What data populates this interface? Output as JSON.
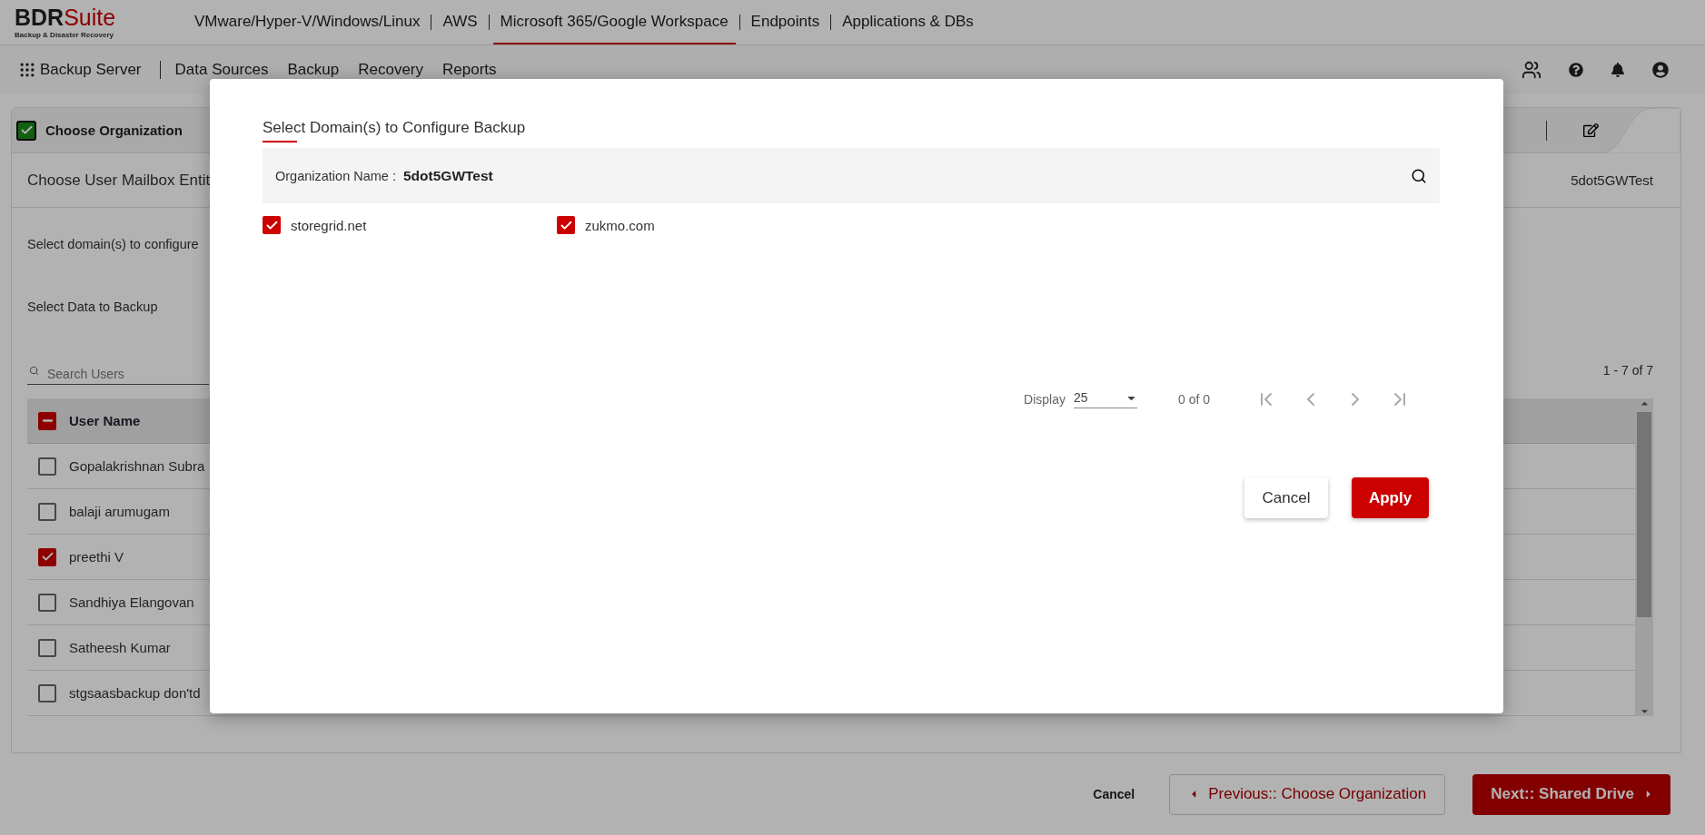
{
  "brand": {
    "name_dark": "BDR",
    "name_red": "Suite",
    "tagline": "Backup & Disaster Recovery"
  },
  "top_tabs": [
    {
      "label": "VMware/Hyper-V/Windows/Linux",
      "selected": false
    },
    {
      "label": "AWS",
      "selected": false
    },
    {
      "label": "Microsoft 365/Google Workspace",
      "selected": true
    },
    {
      "label": "Endpoints",
      "selected": false
    },
    {
      "label": "Applications & DBs",
      "selected": false
    }
  ],
  "nav": {
    "server": "Backup Server",
    "items": [
      "Data Sources",
      "Backup",
      "Recovery",
      "Reports"
    ]
  },
  "step": {
    "label": "Choose Organization",
    "checked": true
  },
  "section": {
    "title": "Choose User Mailbox Entit",
    "organization": "5dot5GWTest"
  },
  "domains_prompt": "Select domain(s) to configure",
  "data_prompt": "Select Data to Backup",
  "search": {
    "placeholder": "Search Users"
  },
  "range": "1 - 7 of 7",
  "table": {
    "header": {
      "label": "User Name",
      "indeterminate": true
    },
    "rows": [
      {
        "name": "Gopalakrishnan Subra",
        "checked": false
      },
      {
        "name": "balaji arumugam",
        "checked": false
      },
      {
        "name": "preethi V",
        "checked": true
      },
      {
        "name": "Sandhiya Elangovan",
        "checked": false
      },
      {
        "name": "Satheesh Kumar",
        "checked": false
      },
      {
        "name": "stgsaasbackup don'td",
        "checked": false
      }
    ]
  },
  "footer": {
    "cancel": "Cancel",
    "previous": "Previous:: Choose Organization",
    "next": "Next:: Shared Drive"
  },
  "modal": {
    "title": "Select Domain(s) to Configure Backup",
    "org_label": "Organization Name :",
    "org_value": "5dot5GWTest",
    "domains": [
      {
        "name": "storegrid.net",
        "checked": true
      },
      {
        "name": "zukmo.com",
        "checked": true
      }
    ],
    "pager": {
      "display_label": "Display",
      "page_size": "25",
      "count": "0 of 0"
    },
    "buttons": {
      "cancel": "Cancel",
      "apply": "Apply"
    }
  }
}
